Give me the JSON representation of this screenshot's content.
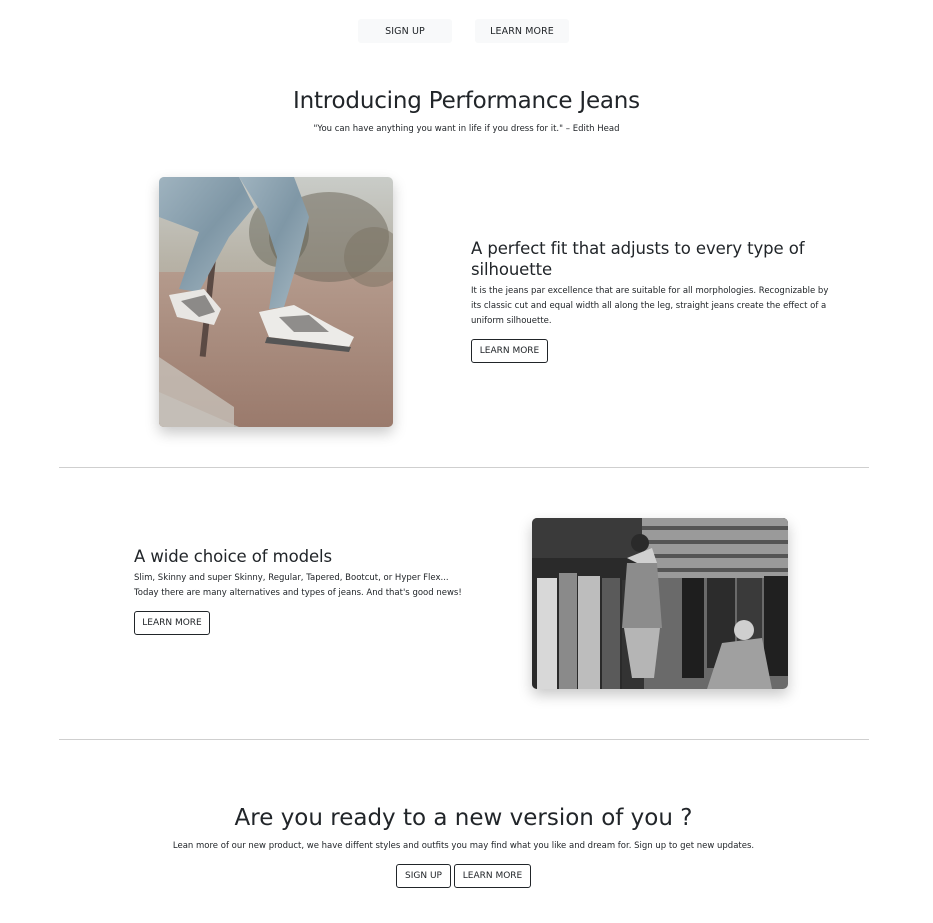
{
  "nav": {
    "signup_label": "SIGN UP",
    "learn_label": "LEARN MORE"
  },
  "hero": {
    "title": "Introducing Performance Jeans",
    "quote": "\"You can have anything you want in life if you dress for it.\" – Edith Head"
  },
  "features": [
    {
      "title": "A perfect fit that adjusts to every type of silhouette",
      "text": "It is the jeans par excellence that are suitable for all morphologies. Recognizable by its classic cut and equal width all along the leg, straight jeans create the effect of a uniform silhouette.",
      "button_label": "LEARN MORE"
    },
    {
      "title": "A wide choice of models",
      "text_line1": "Slim, Skinny and super Skinny, Regular, Tapered, Bootcut, or Hyper Flex...",
      "text_line2": "Today there are many alternatives and types of jeans. And that's good news!",
      "button_label": "LEARN MORE"
    }
  ],
  "cta": {
    "title": "Are you ready to a new version of you ?",
    "text": "Lean more of our new product, we have diffent styles and outfits you may find what you like and dream for. Sign up to get new updates.",
    "signup_label": "SIGN UP",
    "learn_label": "LEARN MORE"
  },
  "colors": {
    "text": "#212529",
    "light_button": "#f8f9fa",
    "divider": "#cfcfcf"
  }
}
